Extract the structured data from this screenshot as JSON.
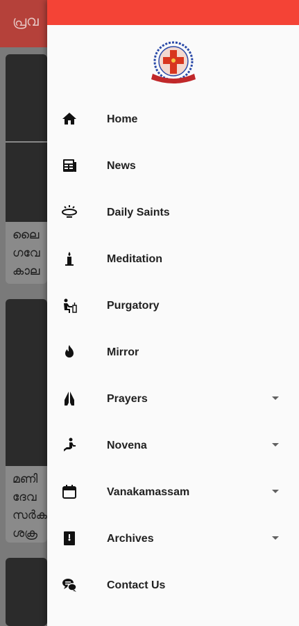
{
  "background": {
    "header_title": "പ്രവ",
    "cards": [
      {
        "lines": [
          "ലൈ",
          "ഗവേ",
          "കാല"
        ]
      },
      {
        "lines": [
          "മണി",
          "ദേവ",
          "സർക",
          "ശക്ര"
        ]
      }
    ]
  },
  "drawer": {
    "logo_alt": "logo",
    "menu": [
      {
        "label": "Home",
        "icon": "home-icon",
        "expandable": false
      },
      {
        "label": "News",
        "icon": "news-icon",
        "expandable": false
      },
      {
        "label": "Daily Saints",
        "icon": "halo-icon",
        "expandable": false
      },
      {
        "label": "Meditation",
        "icon": "candle-icon",
        "expandable": false
      },
      {
        "label": "Purgatory",
        "icon": "praying-person-icon",
        "expandable": false
      },
      {
        "label": "Mirror",
        "icon": "flame-icon",
        "expandable": false
      },
      {
        "label": "Prayers",
        "icon": "praying-hands-icon",
        "expandable": true
      },
      {
        "label": "Novena",
        "icon": "kneeling-icon",
        "expandable": true
      },
      {
        "label": "Vanakamassam",
        "icon": "calendar-icon",
        "expandable": true
      },
      {
        "label": "Archives",
        "icon": "archive-box-icon",
        "expandable": true
      },
      {
        "label": "Contact Us",
        "icon": "chat-icon",
        "expandable": false
      }
    ]
  },
  "colors": {
    "drawer_header": "#f44336",
    "app_header_dimmed": "#b5413a",
    "drawer_bg": "#fafafa"
  }
}
